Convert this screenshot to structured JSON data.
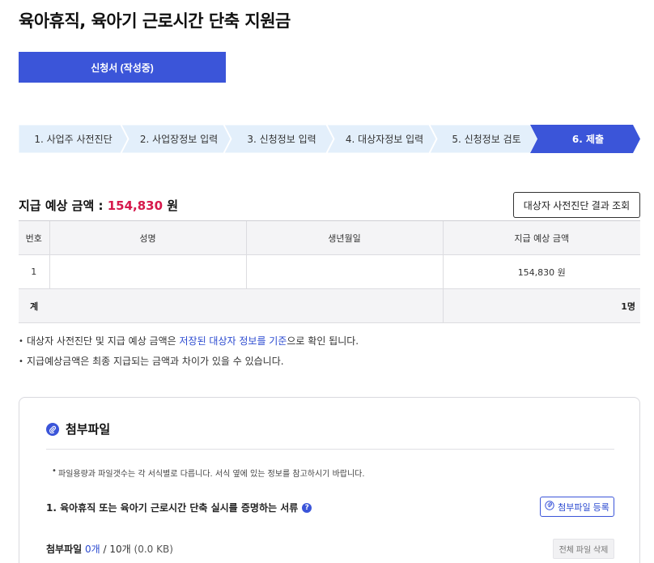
{
  "page": {
    "title": "육아휴직, 육아기 근로시간 단축 지원금",
    "status_button": "신청서 (작성중)"
  },
  "steps": [
    {
      "label": "1. 사업주 사전진단",
      "active": false
    },
    {
      "label": "2. 사업장정보 입력",
      "active": false
    },
    {
      "label": "3. 신청정보 입력",
      "active": false
    },
    {
      "label": "4. 대상자정보 입력",
      "active": false
    },
    {
      "label": "5. 신청정보 검토",
      "active": false
    },
    {
      "label": "6. 제출",
      "active": true
    }
  ],
  "summary": {
    "label": "지급 예상 금액 :",
    "amount": "154,830",
    "unit": "원",
    "lookup_button": "대상자 사전진단 결과 조회"
  },
  "table": {
    "headers": [
      "번호",
      "성명",
      "생년월일",
      "지급 예상 금액"
    ],
    "rows": [
      {
        "no": "1",
        "name": "",
        "birth": "",
        "amount": "154,830 원"
      }
    ],
    "total_label": "계",
    "total_count": "1명"
  },
  "notes": {
    "note1_before": "대상자 사전진단 및 지급 예상 금액은 ",
    "note1_highlight": "저장된 대상자 정보를 기준",
    "note1_after": "으로 확인 됩니다.",
    "note2": "지급예상금액은 최종 지급되는 금액과 차이가 있을 수 있습니다."
  },
  "attachments": {
    "title": "첨부파일",
    "note": "파일용량과 파일갯수는 각 서식별로 다릅니다. 서식 옆에 있는 정보를 참고하시기 바랍니다.",
    "required_doc": "1. 육아휴직 또는 육아기 근로시간 단축 실시를 증명하는 서류",
    "help_glyph": "?",
    "register_button": "첨부파일 등록",
    "count_label": "첨부파일",
    "count_current": "0개",
    "count_separator": "/",
    "count_max": "10개",
    "size": "(0.0 KB)",
    "delete_all_button": "전체 파일 삭제"
  },
  "colors": {
    "primary": "#3b55d9",
    "amount": "#d6194c",
    "step_inactive": "#e3effb",
    "step_active": "#3b55d9"
  },
  "icons": {
    "attachment": "paperclip-icon",
    "help": "help-icon"
  }
}
